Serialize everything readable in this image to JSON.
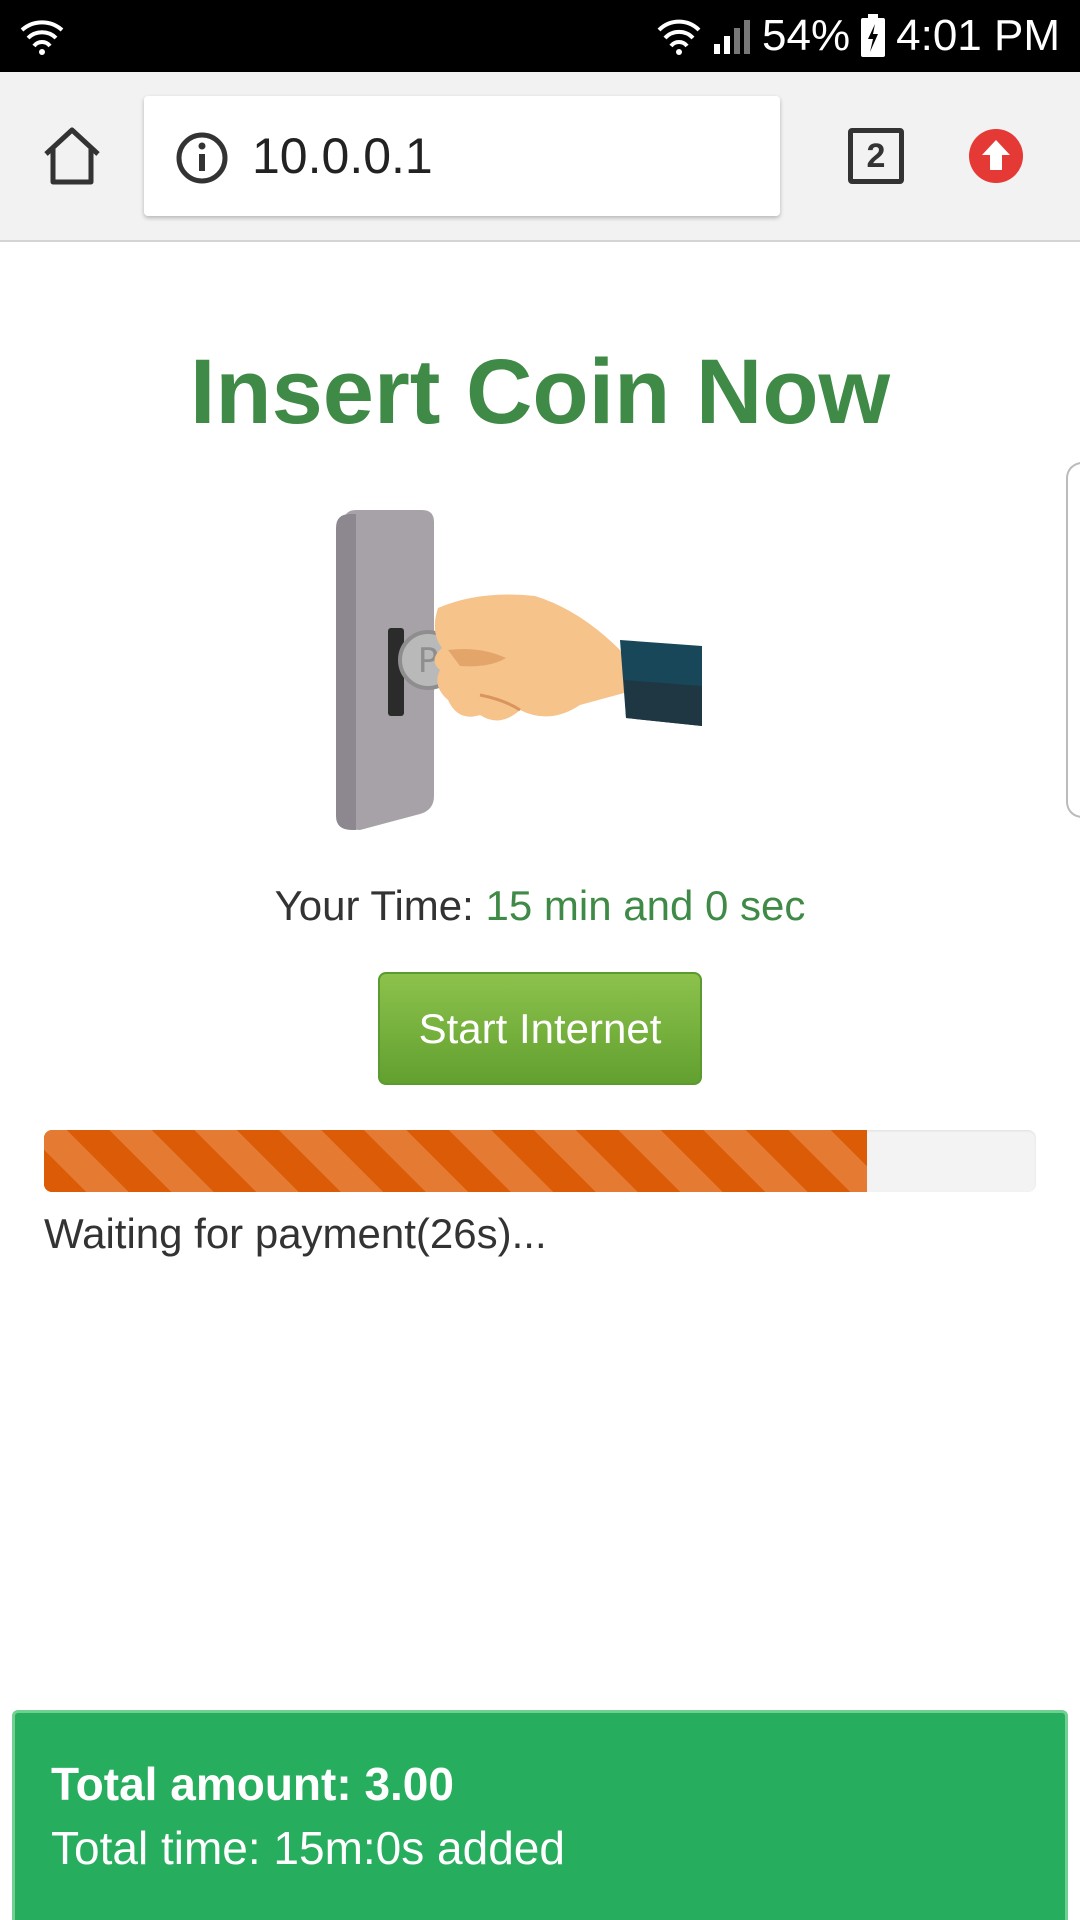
{
  "status_bar": {
    "battery": "54%",
    "time": "4:01 PM",
    "icons": [
      "wifi-question-icon",
      "wifi-icon",
      "signal-icon",
      "battery-charging-icon"
    ]
  },
  "browser": {
    "url": "10.0.0.1",
    "tab_count": "2",
    "icons": [
      "home-icon",
      "info-icon",
      "tabs-icon",
      "upload-icon"
    ]
  },
  "main": {
    "title": "Insert Coin Now",
    "time_label": "Your Time:",
    "time_value": "15 min and 0 sec",
    "start_button": "Start Internet",
    "progress_percent": 83,
    "waiting_text": "Waiting for payment(26s)..."
  },
  "footer": {
    "total_amount": "Total amount: 3.00",
    "total_time": "Total time: 15m:0s added"
  },
  "colors": {
    "title_green": "#3e8a46",
    "button_green": "#62a030",
    "progress_orange": "#db5b06",
    "footer_green": "#27ad5e"
  }
}
